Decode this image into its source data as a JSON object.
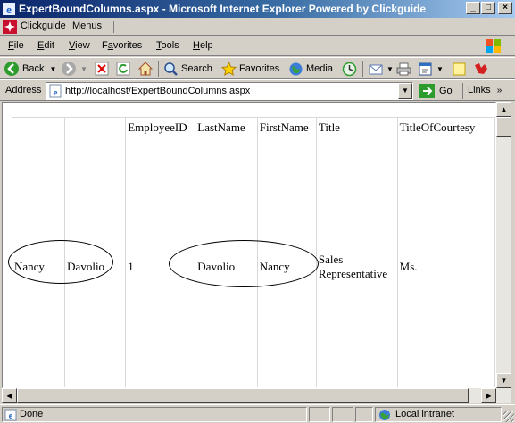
{
  "window": {
    "title": "ExpertBoundColumns.aspx - Microsoft Internet Explorer Powered by Clickguide"
  },
  "clickguide_bar": {
    "name": "Clickguide",
    "menus": "Menus"
  },
  "menu": [
    {
      "label": "File",
      "key": "F",
      "rest": "ile"
    },
    {
      "label": "Edit",
      "key": "E",
      "rest": "dit"
    },
    {
      "label": "View",
      "key": "V",
      "rest": "iew"
    },
    {
      "label": "Favorites",
      "key": "a",
      "pre": "F",
      "rest": "vorites"
    },
    {
      "label": "Tools",
      "key": "T",
      "rest": "ools"
    },
    {
      "label": "Help",
      "key": "H",
      "rest": "elp"
    }
  ],
  "toolbar": {
    "back": "Back",
    "search": "Search",
    "favorites": "Favorites",
    "media": "Media"
  },
  "address": {
    "label": "Address",
    "url": "http://localhost/ExpertBoundColumns.aspx",
    "go": "Go",
    "links": "Links"
  },
  "grid": {
    "headers": [
      "",
      "",
      "EmployeeID",
      "LastName",
      "FirstName",
      "Title",
      "TitleOfCourtesy"
    ],
    "row": [
      "Nancy",
      "Davolio",
      "1",
      "Davolio",
      "Nancy",
      "Sales Representative",
      "Ms."
    ]
  },
  "status": {
    "text": "Done",
    "zone": "Local intranet"
  },
  "colors": {
    "title_start": "#0a246a",
    "title_end": "#a6caf0",
    "chrome": "#d4d0c8"
  }
}
